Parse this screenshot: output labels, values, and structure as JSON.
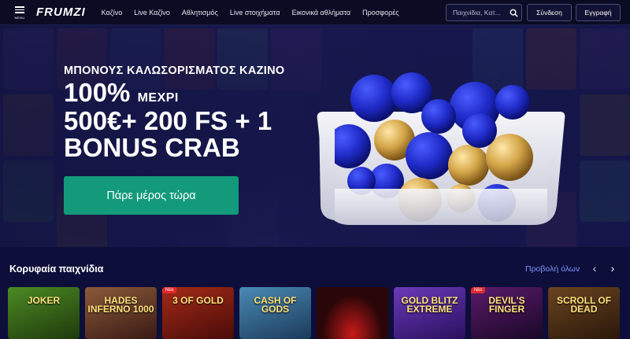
{
  "nav": {
    "menu_label": "MENU",
    "logo": "FRUMZI",
    "links": [
      "Καζίνο",
      "Live Καζίνο",
      "Αθλητισμός",
      "Live στοιχήματα",
      "Εικονικά αθλήματα",
      "Προσφορές"
    ],
    "search_placeholder": "Παιχνίδια, Κατ...",
    "login_label": "Σύνδεση",
    "register_label": "Εγγραφή"
  },
  "hero": {
    "subtitle": "ΜΠΟΝΟΥΣ ΚΑΛΩΣΟΡΙΣΜΑΤΟΣ ΚΑΖΙΝΟ",
    "line1_big": "100%",
    "line1_small": "ΜΕΧΡΙ",
    "line2": "500€+ 200 FS + 1",
    "line3": "BONUS CRAB",
    "cta_label": "Πάρε μέρος τώρα"
  },
  "top_games": {
    "title": "Κορυφαία παιχνίδια",
    "view_all": "Προβολή όλων",
    "cards": [
      {
        "title": "JOKER",
        "new": false,
        "bg": "#3a6a1c"
      },
      {
        "title": "HADES INFERNO 1000",
        "new": false,
        "bg": "#5a2e22"
      },
      {
        "title": "3 OF GOLD",
        "new": true,
        "bg": "#7a1c14"
      },
      {
        "title": "CASH OF GODS",
        "new": false,
        "bg": "#2f5c7a"
      },
      {
        "title": "",
        "new": false,
        "bg": "#2a0608"
      },
      {
        "title": "GOLD BLITZ EXTREME",
        "new": false,
        "bg": "#4a2a8a"
      },
      {
        "title": "DEVIL'S FINGER",
        "new": true,
        "bg": "#2a1040"
      },
      {
        "title": "SCROLL OF DEAD",
        "new": false,
        "bg": "#3b2512"
      }
    ],
    "new_badge": "Νέο"
  },
  "colors": {
    "accent": "#139a7a",
    "link": "#7b95ff",
    "background": "#0d0e3a"
  }
}
